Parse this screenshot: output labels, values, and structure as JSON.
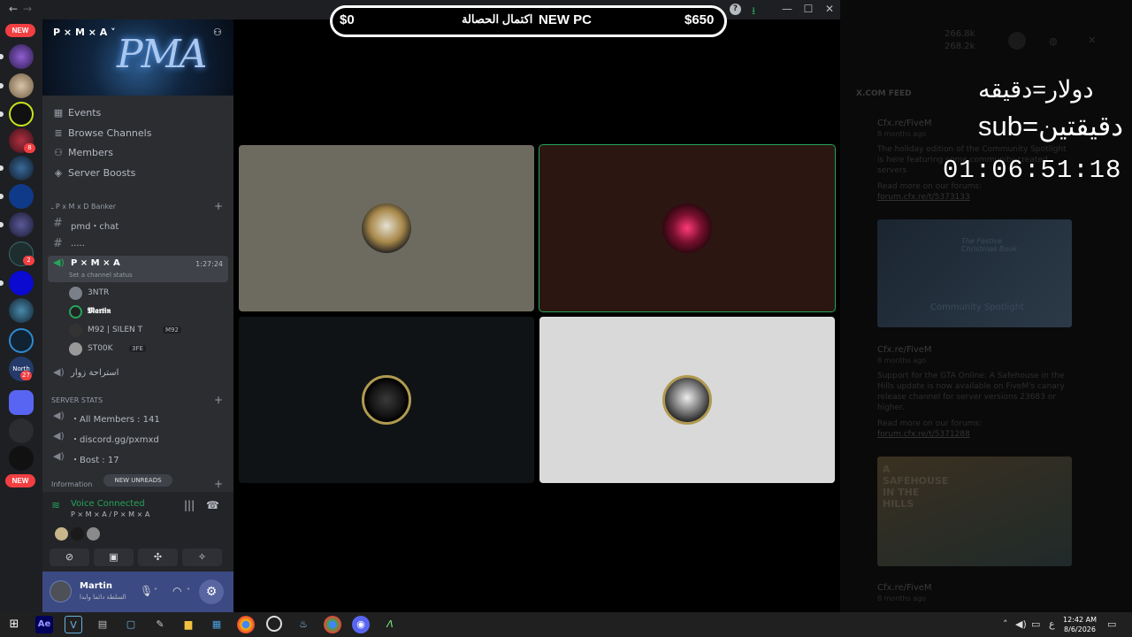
{
  "overlay_goal": {
    "left": "$0",
    "middle_ar": "اكتمال الحصالة",
    "middle_en": "NEW PC",
    "right": "$650"
  },
  "rail": {
    "new_top": "NEW",
    "new_bottom": "NEW",
    "badge_8": "8",
    "badge_2": "2",
    "badge_27": "27",
    "north": "North"
  },
  "server": {
    "name": "P × M × A",
    "banner_text": "PMA",
    "menu": [
      "Events",
      "Browse Channels",
      "Members",
      "Server Boosts"
    ],
    "category_1": "ـ P x M x D Banker",
    "ch_chat": "pmd・chat",
    "ch_dots": ".....",
    "voice_channel": "P × M × A",
    "voice_time": "1:27:24",
    "channel_status": "Set a channel status",
    "users": [
      {
        "name": "3NTR",
        "tag": ""
      },
      {
        "name": "𝕸𝖆𝖗𝖙𝖎𝖓",
        "tag": ""
      },
      {
        "name": "M92 | SILEN T",
        "tag": "M92"
      },
      {
        "name": "ST00K",
        "tag": "3FE"
      }
    ],
    "ch_rest": "استراحة زوار",
    "category_2": "SERVER STATS",
    "stat_members": "・All Members : 141",
    "stat_invite": "・discord.gg/pxmxd",
    "stat_bost": "・Bost : 17",
    "category_3": "Information",
    "new_unreads": "NEW UNREADS"
  },
  "voice": {
    "status": "Voice Connected",
    "location": "P × M × A / P × M × A"
  },
  "user": {
    "name": "Martin",
    "status": "السلطة دائما وابدا"
  },
  "stage": {
    "tile_colors": [
      "#6d6b5f",
      "#2c1611",
      "#101316",
      "#d9d9d9"
    ],
    "active_border": "#23a55a"
  },
  "right": {
    "feed_header": "X.COM FEED",
    "views": "266.8k",
    "shares": "268.2k",
    "line1": "دولار=دقيقه",
    "line2": "sub=دقيقتين",
    "timer": "01:06:51:18",
    "posts": [
      {
        "src": "Cfx.re/FiveM",
        "time": "8 months ago",
        "text": "The holiday edition of the Community Spotlight is here featuring some community-created servers",
        "more": "Read more on our forums:",
        "link": "forum.cfx.re/t/5373133",
        "image_caption": "Community Spotlight",
        "image_sub": "The Festive Christmas Book"
      },
      {
        "src": "Cfx.re/FiveM",
        "time": "8 months ago",
        "text": "Support for the GTA Online: A Safehouse in the Hills update is now available on FiveM's canary release channel for server versions 23683 or higher.",
        "more": "Read more on our forums:",
        "link": "forum.cfx.re/t/5371288",
        "image_caption": "A SAFEHOUSE IN THE HILLS"
      },
      {
        "src": "Cfx.re/FiveM",
        "time": "8 months ago"
      }
    ]
  },
  "taskbar": {
    "time": "12:42 AM",
    "date": "8/6/2026",
    "lang": "ع"
  }
}
